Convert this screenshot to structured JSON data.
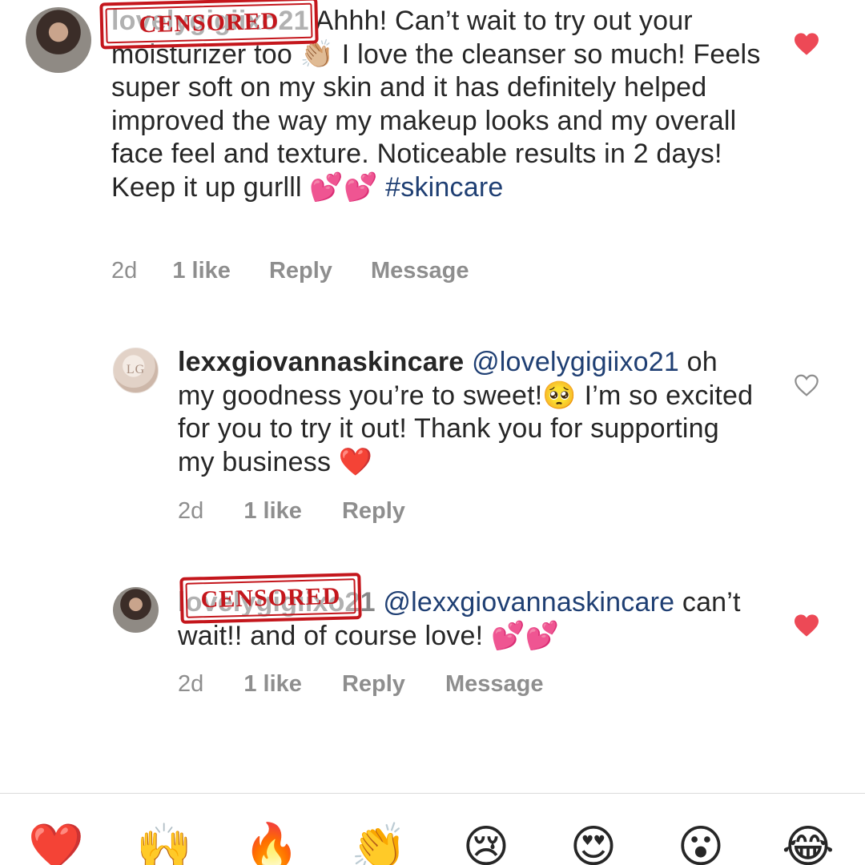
{
  "comments": [
    {
      "username": "lovelygigiixo21",
      "censor_label": "CENSORED",
      "text_part1": " Ahhh! Can’t wait to try out your moisturizer too ",
      "emoji1": "👏🏼",
      "text_part2": " I love the cleanser so much! Feels super soft on my skin and it has definitely helped improved the way my makeup looks and my overall face feel and texture. Noticeable results in 2 days! Keep it up gurlll ",
      "emoji2": "💕💕",
      "hashtag": "#skincare",
      "time": "2d",
      "likes": "1 like",
      "reply": "Reply",
      "message": "Message",
      "liked": true
    },
    {
      "username": "lexxgiovannaskincare",
      "mention": "@lovelygigiixo21",
      "text_part1": "oh my goodness you’re to sweet!",
      "emoji1": "🥺",
      "text_part2": " I’m so excited for you to try it out! Thank you for supporting my business ",
      "emoji2": "❤️",
      "time": "2d",
      "likes": "1 like",
      "reply": "Reply",
      "liked": false
    },
    {
      "username": "lovelygigiixo21",
      "censor_label": "CENSORED",
      "mention": "@lexxgiovannaskincare",
      "text_part1": "can’t wait!! and of course love! ",
      "emoji1": "💕💕",
      "time": "2d",
      "likes": "1 like",
      "reply": "Reply",
      "message": "Message",
      "liked": true
    }
  ],
  "reactions": [
    "❤️",
    "🙌",
    "🔥",
    "👏",
    "😢",
    "😍",
    "😮",
    "😂"
  ],
  "colors": {
    "heart_liked": "#ed4956",
    "heart_outline": "#8e8e8e",
    "mention": "#1f3f73",
    "meta": "#8e8e8e",
    "censor": "#c4161c"
  }
}
